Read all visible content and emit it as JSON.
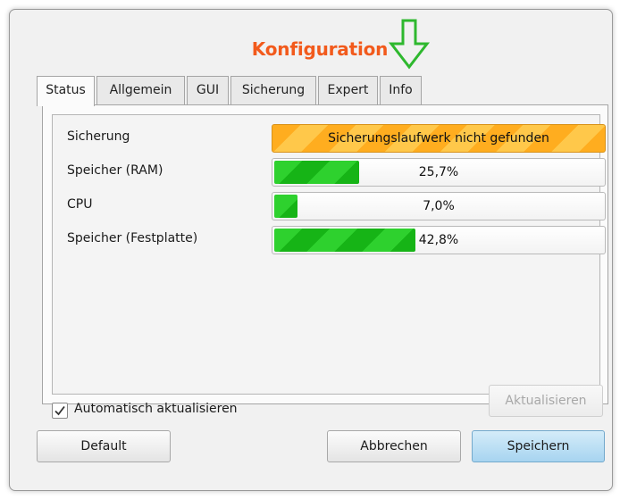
{
  "window": {
    "title": "Konfiguration"
  },
  "tabs": [
    {
      "label": "Status",
      "active": true
    },
    {
      "label": "Allgemein",
      "active": false
    },
    {
      "label": "GUI",
      "active": false
    },
    {
      "label": "Sicherung",
      "active": false
    },
    {
      "label": "Expert",
      "active": false
    },
    {
      "label": "Info",
      "active": false
    }
  ],
  "status": {
    "rows": [
      {
        "label": "Sicherung",
        "value_text": "Sicherungslaufwerk nicht gefunden",
        "state": "warning"
      },
      {
        "label": "Speicher (RAM)",
        "value_text": "25,7%",
        "percent": 25.7
      },
      {
        "label": "CPU",
        "value_text": "7,0%",
        "percent": 7.0
      },
      {
        "label": "Speicher (Festplatte)",
        "value_text": "42,8%",
        "percent": 42.8
      }
    ]
  },
  "auto_update": {
    "label": "Automatisch aktualisieren",
    "checked": true
  },
  "buttons": {
    "refresh": "Aktualisieren",
    "default": "Default",
    "cancel": "Abbrechen",
    "save": "Speichern"
  },
  "annotation": {
    "icon": "arrow-down-icon",
    "color": "#2eb82e"
  },
  "colors": {
    "title": "#f25a1c",
    "progress": "#22c422",
    "warning": "#ffad1f",
    "primary_button": "#a7d4f0"
  }
}
